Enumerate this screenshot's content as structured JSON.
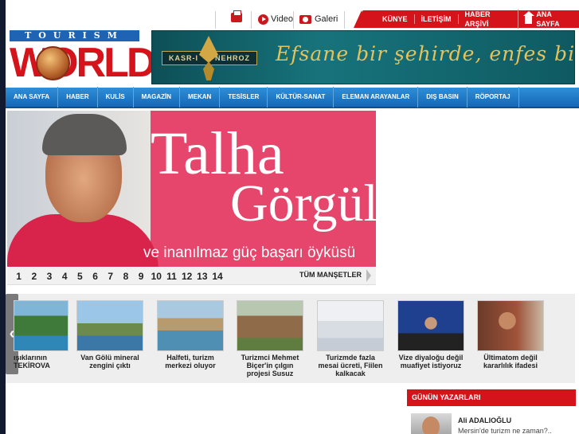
{
  "topbar": {
    "video_label": "Video",
    "galeri_label": "Galeri",
    "links": [
      {
        "label": "KÜNYE"
      },
      {
        "label": "İLETİŞİM"
      },
      {
        "label": "HABER ARŞİVİ"
      },
      {
        "label": "ANA SAYFA"
      }
    ]
  },
  "logo": {
    "top": "TOURISM",
    "main": "WORLD"
  },
  "banner": {
    "brand_left": "KASR-I",
    "brand_right": "NEHROZ",
    "tagline": "Efsane bir şehirde, enfes bir tatil..."
  },
  "nav": {
    "items": [
      "ANA SAYFA",
      "HABER",
      "KULİS",
      "MAGAZİN",
      "MEKAN",
      "TESİSLER",
      "KÜLTÜR-SANAT",
      "ELEMAN ARAYANLAR",
      "DIŞ BASIN",
      "RÖPORTAJ"
    ]
  },
  "hero": {
    "name_line1": "Talha",
    "name_line2": "Görgülü",
    "subtitle": "ve inanılmaz güç başarı öyküsü"
  },
  "pager": {
    "pages": [
      "1",
      "2",
      "3",
      "4",
      "5",
      "6",
      "7",
      "8",
      "9",
      "10",
      "11",
      "12",
      "13",
      "14"
    ],
    "all_label": "TÜM MANŞETLER"
  },
  "carousel": {
    "arrow": "‹",
    "items": [
      {
        "caption": "ışıklarının TEKİROVA"
      },
      {
        "caption": "Van Gölü mineral zengini çıktı"
      },
      {
        "caption": "Halfeti, turizm merkezi oluyor"
      },
      {
        "caption": "Turizmci Mehmet Biçer'in çılgın projesi Susuz"
      },
      {
        "caption": "Turizmde fazla mesai ücreti, Fiilen kalkacak"
      },
      {
        "caption": "Vize diyaloğu değil muafiyet istiyoruz"
      },
      {
        "caption": "Ültimatom değil kararlılık ifadesi"
      }
    ]
  },
  "yazarlar": {
    "heading": "GÜNÜN YAZARLARI",
    "writer": {
      "name": "Ali ADALIOĞLU",
      "title": "Mersin'de turizm ne zaman?.."
    }
  },
  "colors": {
    "brand_red": "#d4131b",
    "nav_blue": "#1567b6",
    "hero_pink": "#e6466b"
  }
}
